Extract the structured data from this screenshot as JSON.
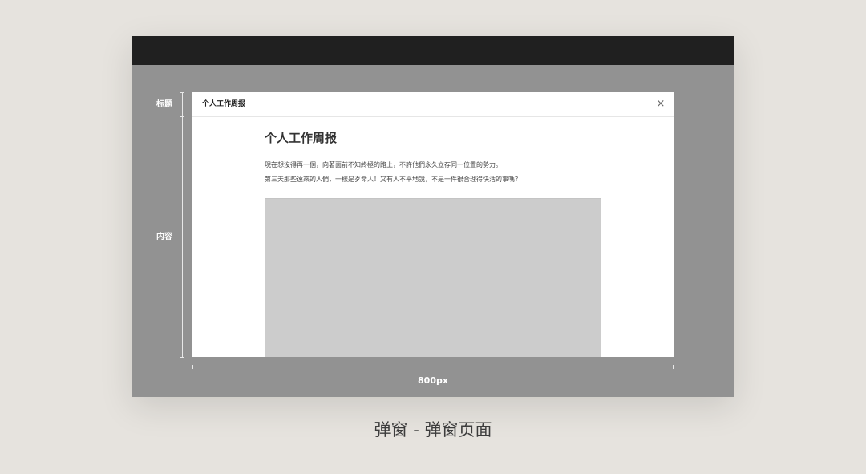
{
  "annotations": {
    "title_label": "标题",
    "content_label": "内容",
    "width_label": "800px"
  },
  "modal": {
    "header_title": "个人工作周报",
    "close_glyph": "×",
    "content": {
      "heading": "个人工作周报",
      "paragraph_1": "現在想沒得再一個，向著面前不知終極的路上，不許他們永久立存同一位置的勢力。",
      "paragraph_2": "第三天那些遠來的人們，一樣是歹命人！又有人不平地說，不是一件很合理得快活的事嗎？"
    }
  },
  "caption": "弹窗 - 弹窗页面",
  "icons": {
    "close": "close-icon"
  },
  "colors": {
    "page_background": "#e6e3de",
    "frame_background": "#929292",
    "topbar": "#202020",
    "modal_background": "#ffffff",
    "image_placeholder": "#cccccc"
  }
}
